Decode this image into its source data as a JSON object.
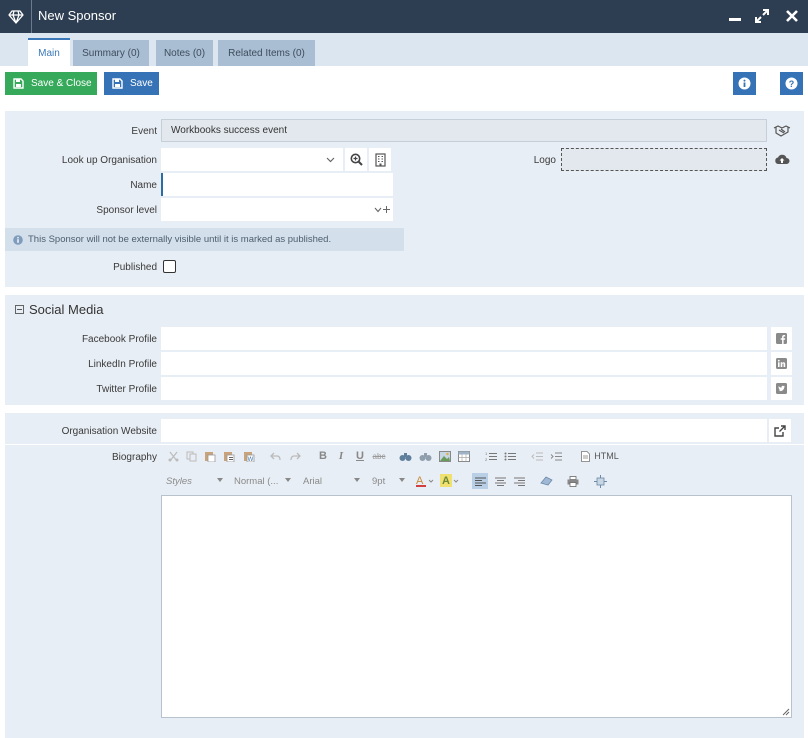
{
  "window": {
    "title": "New Sponsor",
    "logo_icon": "diamond-icon",
    "controls": [
      "minimize-icon",
      "maximize-icon",
      "close-icon"
    ]
  },
  "tabs": [
    {
      "label": "Main",
      "active": true
    },
    {
      "label": "Summary (0)",
      "active": false
    },
    {
      "label": "Notes (0)",
      "active": false
    },
    {
      "label": "Related Items (0)",
      "active": false
    }
  ],
  "toolbar": {
    "save_close_label": "Save & Close",
    "save_label": "Save",
    "info_icon": "info-icon",
    "help_icon": "help-icon"
  },
  "form": {
    "event_label": "Event",
    "event_value": "Workbooks success event",
    "lookup_org_label": "Look up Organisation",
    "lookup_org_value": "",
    "name_label": "Name",
    "name_value": "",
    "sponsor_level_label": "Sponsor level",
    "sponsor_level_value": "",
    "logo_label": "Logo",
    "notice": "This Sponsor will not be externally visible until it is marked as published.",
    "published_label": "Published",
    "published_checked": false
  },
  "social": {
    "title": "Social Media",
    "facebook_label": "Facebook Profile",
    "linkedin_label": "LinkedIn Profile",
    "twitter_label": "Twitter Profile"
  },
  "website": {
    "label": "Organisation Website",
    "value": ""
  },
  "biography": {
    "label": "Biography",
    "html_label": "HTML",
    "styles_placeholder": "Styles",
    "format_value": "Normal (...",
    "font_value": "Arial",
    "size_value": "9pt",
    "content": ""
  },
  "colors": {
    "titlebar": "#2e3e52",
    "save_close": "#36a95a",
    "save": "#3672b6",
    "panel": "#e8eef5",
    "tab_inactive": "#a9bed2"
  }
}
